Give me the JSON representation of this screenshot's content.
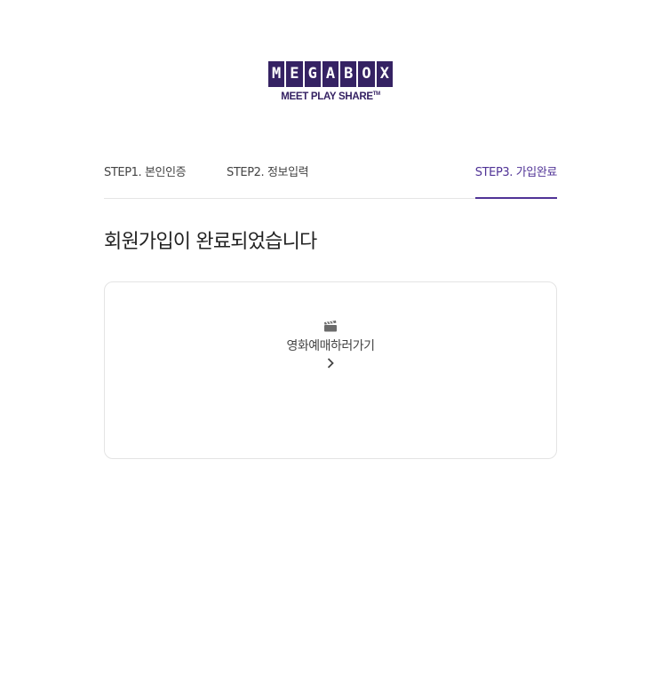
{
  "logo": {
    "letters": [
      "M",
      "E",
      "G",
      "A",
      "B",
      "O",
      "X"
    ],
    "tagline": "MEET PLAY SHARE",
    "trademark": "TM"
  },
  "steps": [
    {
      "label": "STEP1. 본인인증",
      "active": false
    },
    {
      "label": "STEP2. 정보입력",
      "active": false
    },
    {
      "label": "STEP3. 가입완료",
      "active": true
    }
  ],
  "main": {
    "heading": "회원가입이 완료되었습니다"
  },
  "card": {
    "icon": "clapperboard-icon",
    "label": "영화예매하러가기",
    "arrow_icon": "chevron-right-icon"
  },
  "colors": {
    "brand": "#352263",
    "accent": "#503396",
    "divider": "#e5e5e5"
  }
}
